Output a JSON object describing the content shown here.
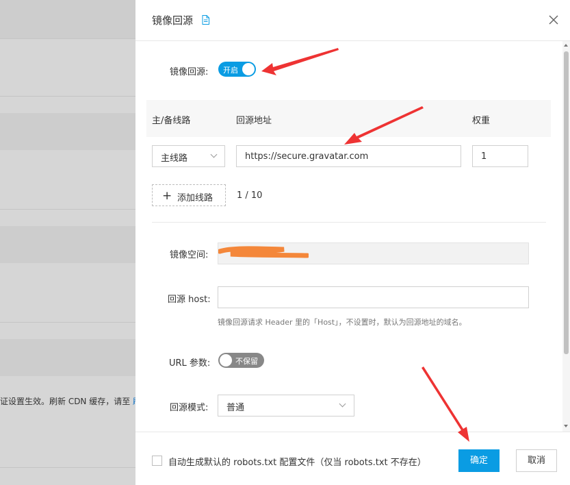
{
  "background": {
    "notice_text": "证设置生效。刷新 CDN 缓存，请至 ",
    "notice_link": "刷"
  },
  "drawer": {
    "title": "镜像回源",
    "mirror_toggle": {
      "label": "镜像回源:",
      "state": "开启"
    },
    "routes": {
      "headers": {
        "line": "主/备线路",
        "address": "回源地址",
        "weight": "权重"
      },
      "rows": [
        {
          "line": "主线路",
          "address": "https://secure.gravatar.com",
          "weight": "1"
        }
      ],
      "add_label": "添加线路",
      "count": "1 / 10"
    },
    "mirror_space": {
      "label": "镜像空间:",
      "value": ""
    },
    "host": {
      "label": "回源 host:",
      "value": "",
      "hint": "镜像回源请求 Header 里的「Host」，不设置时，默认为回源地址的域名。"
    },
    "url_params": {
      "label": "URL 参数:",
      "state": "不保留"
    },
    "mode": {
      "label": "回源模式:",
      "value": "普通"
    }
  },
  "footer": {
    "robots_label": "自动生成默认的 robots.txt 配置文件（仅当 robots.txt 不存在）",
    "confirm": "确定",
    "cancel": "取消"
  },
  "colors": {
    "primary": "#0a9ce3",
    "annotation_arrow": "#ee3333",
    "redaction": "#f4873a"
  }
}
